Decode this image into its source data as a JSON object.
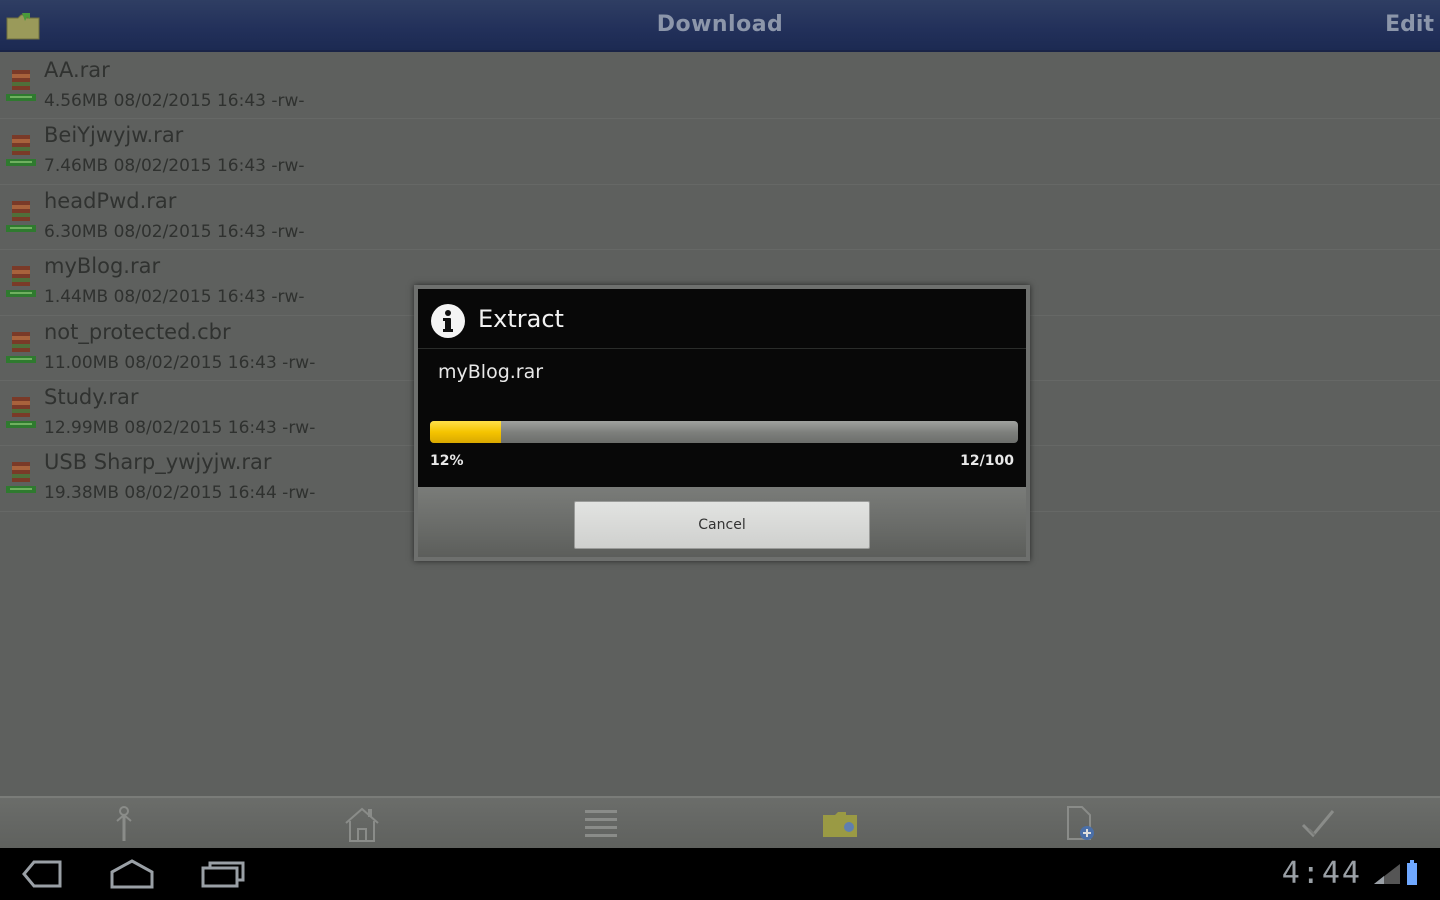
{
  "app": {
    "title": "Download",
    "edit_label": "Edit"
  },
  "files": [
    {
      "name": "AA.rar",
      "meta": "4.56MB 08/02/2015 16:43 -rw-"
    },
    {
      "name": "BeiYjwyjw.rar",
      "meta": "7.46MB 08/02/2015 16:43 -rw-"
    },
    {
      "name": "headPwd.rar",
      "meta": "6.30MB 08/02/2015 16:43 -rw-"
    },
    {
      "name": "myBlog.rar",
      "meta": "1.44MB 08/02/2015 16:43 -rw-"
    },
    {
      "name": "not_protected.cbr",
      "meta": "11.00MB 08/02/2015 16:43 -rw-"
    },
    {
      "name": "Study.rar",
      "meta": "12.99MB 08/02/2015 16:43 -rw-"
    },
    {
      "name": "USB Sharp_ywjyjw.rar",
      "meta": "19.38MB 08/02/2015 16:44 -rw-"
    }
  ],
  "dialog": {
    "title": "Extract",
    "filename": "myBlog.rar",
    "progress_percent": 12,
    "progress_label": "12%",
    "progress_count": "12/100",
    "cancel_label": "Cancel"
  },
  "toolbar": {
    "items": [
      {
        "icon": "up-level-icon"
      },
      {
        "icon": "home-icon"
      },
      {
        "icon": "list-view-icon"
      },
      {
        "icon": "new-folder-icon"
      },
      {
        "icon": "new-file-icon"
      },
      {
        "icon": "select-all-icon"
      }
    ]
  },
  "system": {
    "clock": "4:44",
    "nav_icons": [
      "back-icon",
      "home-icon",
      "recent-apps-icon"
    ]
  },
  "colors": {
    "progress_fill": "#f5c400",
    "titlebar": "#22305a",
    "overlay_bg": "#5e605e"
  }
}
